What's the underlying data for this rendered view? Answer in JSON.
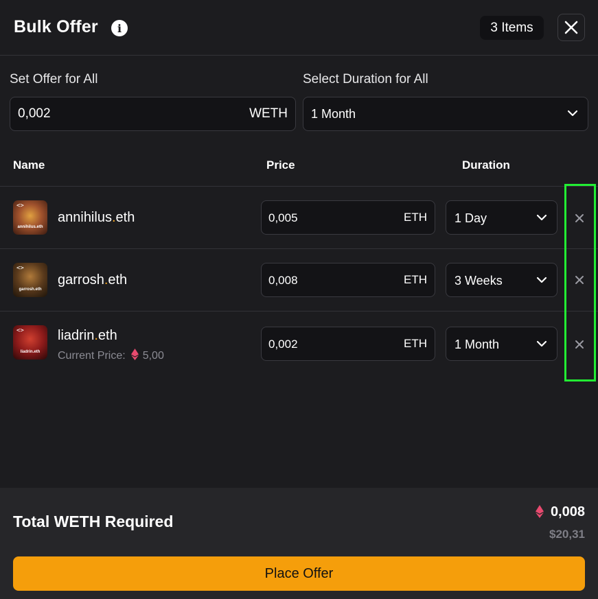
{
  "header": {
    "title": "Bulk Offer",
    "info_icon": "info-icon",
    "items_badge": "3 Items",
    "close_icon": "close-icon"
  },
  "set_all": {
    "offer_label": "Set Offer for All",
    "offer_value": "0,002",
    "offer_unit": "WETH",
    "duration_label": "Select Duration for All",
    "duration_value": "1 Month"
  },
  "columns": {
    "name": "Name",
    "price": "Price",
    "duration": "Duration"
  },
  "items": [
    {
      "name_main": "annihilus",
      "name_dot": ".",
      "name_tld": "eth",
      "avatar_label": "annihilus.eth",
      "avatar_color": "#a0522d",
      "price": "0,005",
      "price_unit": "ETH",
      "duration": "1 Day",
      "current_price_label": "",
      "current_price_value": ""
    },
    {
      "name_main": "garrosh",
      "name_dot": ".",
      "name_tld": "eth",
      "avatar_label": "garrosh.eth",
      "avatar_color": "#5a3a1c",
      "price": "0,008",
      "price_unit": "ETH",
      "duration": "3 Weeks",
      "current_price_label": "",
      "current_price_value": ""
    },
    {
      "name_main": "liadrin",
      "name_dot": ".",
      "name_tld": "eth",
      "avatar_label": "liadrin.eth",
      "avatar_color": "#8b1a1a",
      "price": "0,002",
      "price_unit": "ETH",
      "duration": "1 Month",
      "current_price_label": "Current Price:",
      "current_price_value": "5,00"
    }
  ],
  "footer": {
    "total_label": "Total WETH Required",
    "total_eth": "0,008",
    "total_usd": "$20,31",
    "place_offer": "Place Offer"
  },
  "colors": {
    "background": "#1c1c1f",
    "accent": "#f59e0b",
    "eth_icon": "#e84a6f",
    "highlight": "#22ee33"
  }
}
